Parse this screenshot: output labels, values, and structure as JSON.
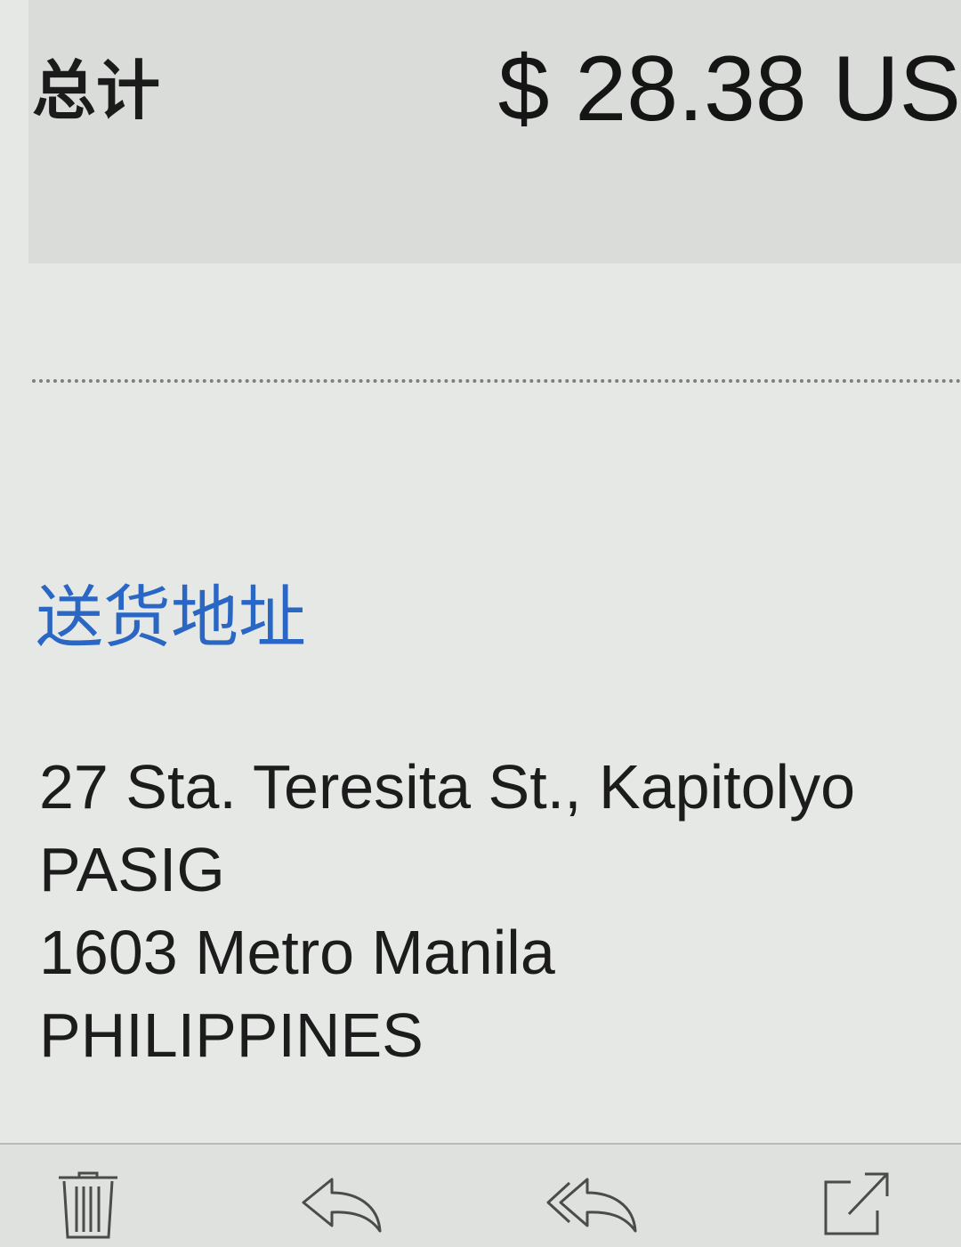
{
  "summary": {
    "total_label": "总计",
    "total_amount": "$ 28.38 US"
  },
  "shipping": {
    "heading": "送货地址",
    "address_lines": [
      "27 Sta. Teresita St., Kapitolyo",
      "PASIG",
      "1603 Metro Manila",
      "PHILIPPINES"
    ]
  },
  "toolbar": {
    "icons": [
      "trash-icon",
      "reply-icon",
      "reply-all-icon",
      "share-icon"
    ]
  },
  "colors": {
    "background": "#e6e8e5",
    "total_block": "#dadcd9",
    "link_blue": "#2a67c4",
    "text": "#1c1c1c"
  }
}
